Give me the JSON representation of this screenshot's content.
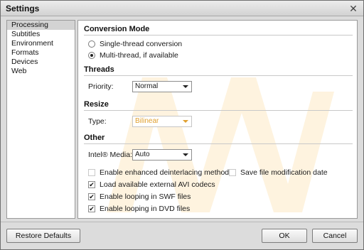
{
  "window": {
    "title": "Settings"
  },
  "sidebar": {
    "items": [
      {
        "label": "Processing"
      },
      {
        "label": "Subtitles"
      },
      {
        "label": "Environment"
      },
      {
        "label": "Formats"
      },
      {
        "label": "Devices"
      },
      {
        "label": "Web"
      }
    ],
    "selected": "Processing"
  },
  "conversion_mode": {
    "title": "Conversion Mode",
    "single_label": "Single-thread conversion",
    "multi_label": "Multi-thread, if available",
    "selected": "multi"
  },
  "threads": {
    "title": "Threads",
    "priority_label": "Priority:",
    "priority_value": "Normal"
  },
  "resize": {
    "title": "Resize",
    "type_label": "Type:",
    "type_value": "Bilinear"
  },
  "other": {
    "title": "Other",
    "intel_label": "Intel® Media:",
    "intel_value": "Auto",
    "deinterlace_label": "Enable enhanced deinterlacing method",
    "deinterlace_checked": false,
    "save_date_label": "Save file modification date",
    "save_date_checked": false,
    "avi_label": "Load available external AVI codecs",
    "avi_checked": true,
    "swf_label": "Enable looping in SWF files",
    "swf_checked": true,
    "dvd_label": "Enable looping in DVD files",
    "dvd_checked": true
  },
  "buttons": {
    "restore": "Restore Defaults",
    "ok": "OK",
    "cancel": "Cancel"
  },
  "colors": {
    "watermark": "#f6b43a"
  }
}
